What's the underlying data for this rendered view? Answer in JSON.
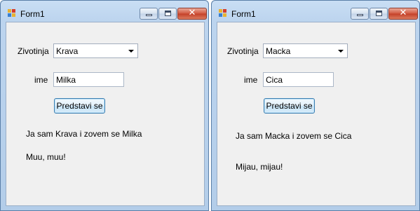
{
  "windows": [
    {
      "title": "Form1",
      "animal_label": "Zivotinja",
      "animal_value": "Krava",
      "name_label": "ime",
      "name_value": "Milka",
      "button_label": "Predstavi se",
      "intro_text": "Ja sam Krava i zovem se Milka",
      "sound_text": "Muu, muu!"
    },
    {
      "title": "Form1",
      "animal_label": "Zivotinja",
      "animal_value": "Macka",
      "name_label": "ime",
      "name_value": "Cica",
      "button_label": "Predstavi se",
      "intro_text": "Ja sam Macka i zovem se Cica",
      "sound_text": "Mijau, mijau!"
    }
  ],
  "caption_buttons": {
    "close_glyph": "✕"
  },
  "icons": {
    "app_icon": "form-app-icon",
    "minimize": "minimize-icon",
    "maximize": "maximize-icon",
    "close": "close-icon",
    "dropdown_arrow": "chevron-down-icon"
  },
  "colors": {
    "frame": "#b9d1ea",
    "client_background": "#f0f0f0",
    "close_button": "#c7432c",
    "button_border": "#3c7fb1"
  }
}
